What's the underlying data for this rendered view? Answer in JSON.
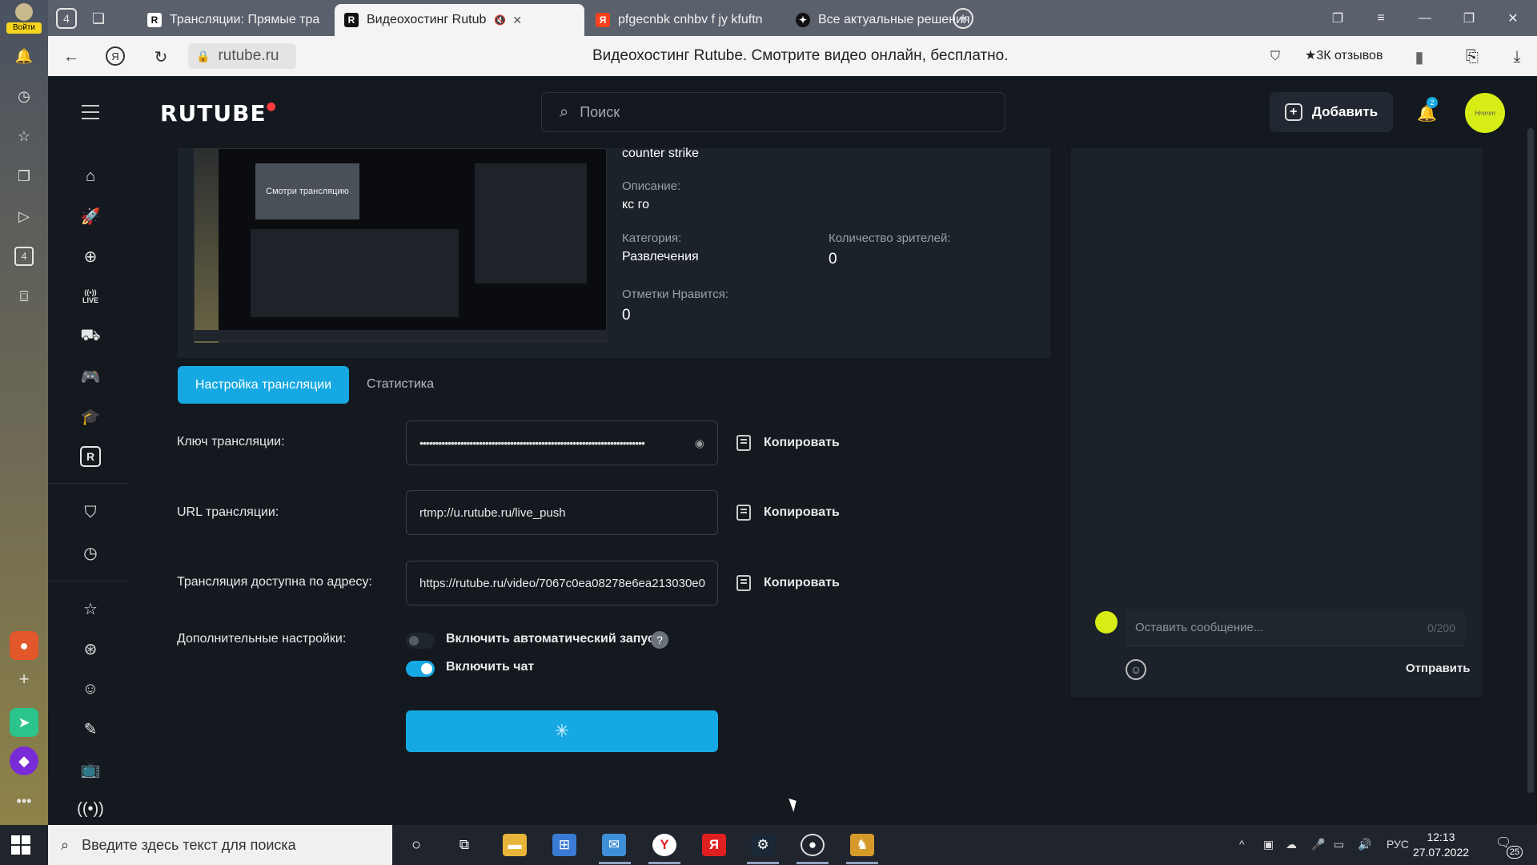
{
  "browser": {
    "login_label": "Войти",
    "side_badge": "4",
    "tabs": [
      {
        "label": "Трансляции: Прямые тра",
        "favicon": "R"
      },
      {
        "label": "Видеохостинг Rutub",
        "favicon": "R"
      },
      {
        "label": "pfgecnbk cnhbv f jy kfuftn",
        "favicon": "Я"
      },
      {
        "label": "Все актуальные решения",
        "favicon": "✦"
      }
    ],
    "tab_counter": "4",
    "url": "rutube.ru",
    "page_title": "Видеохостинг Rutube. Смотрите видео онлайн, бесплатно.",
    "reviews": "3К отзывов",
    "icons": [
      "bell-icon",
      "history-icon",
      "star-icon",
      "collections-icon",
      "video-icon",
      "camera-icon"
    ]
  },
  "header": {
    "logo": "RUTUBE",
    "search_placeholder": "Поиск",
    "add_label": "Добавить",
    "notif_count": "2",
    "avatar_text": "Hmmm"
  },
  "stream": {
    "thumb_caption": "Смотри трансляцию",
    "title": "counter strike",
    "description_label": "Описание:",
    "description": "кс го",
    "category_label": "Категория:",
    "category": "Развлечения",
    "viewers_label": "Количество зрителей:",
    "viewers": "0",
    "likes_label": "Отметки Нравится:",
    "likes": "0"
  },
  "tabs": {
    "settings": "Настройка трансляции",
    "stats": "Статистика"
  },
  "form": {
    "key_label": "Ключ трансляции:",
    "key_value": "••••••••••••••••••••••••••••••••••••••••••••••••••••••••••••••••••••••••",
    "url_label": "URL трансляции:",
    "url_value": "rtmp://u.rutube.ru/live_push",
    "public_label": "Трансляция доступна по адресу:",
    "public_value": "https://rutube.ru/video/7067c0ea08278e6ea213030e0",
    "copy_label": "Копировать",
    "extra_label": "Дополнительные настройки:",
    "autostart_label": "Включить автоматический запуск",
    "autostart_on": false,
    "chat_label": "Включить чат",
    "chat_on": true,
    "help": "?"
  },
  "chat": {
    "placeholder": "Оставить сообщение...",
    "counter": "0/200",
    "send": "Отправить"
  },
  "taskbar": {
    "search_placeholder": "Введите здесь текст для поиска",
    "lang": "РУС",
    "time": "12:13",
    "date": "27.07.2022",
    "notif_count": "25"
  },
  "colors": {
    "accent": "#16a8e2",
    "avatar": "#d6ee16",
    "bg": "#14191f"
  }
}
